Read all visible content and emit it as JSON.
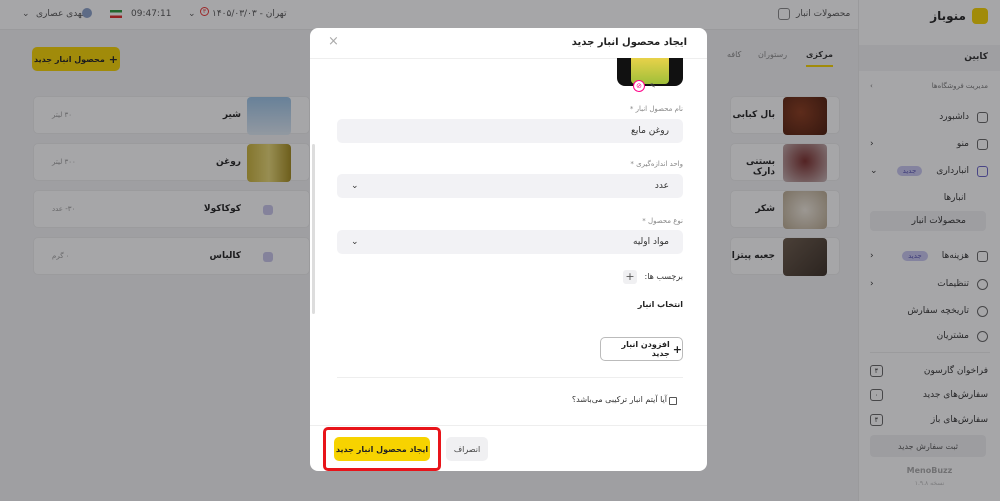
{
  "brand": {
    "name": "منوباز"
  },
  "topbar": {
    "page_label": "محصولات انبار",
    "date": "۱۴۰۵/۰۳/۰۳ - تهران",
    "time": "09:47:11",
    "user": "مهدی عصاری"
  },
  "sidebar": {
    "section": "کابین",
    "manage_stores": "مدیریت فروشگاه‌ها",
    "items": [
      {
        "label": "داشبورد"
      },
      {
        "label": "منو"
      },
      {
        "label": "انبارداری",
        "badge": "جدید"
      },
      {
        "label": "انبارها"
      },
      {
        "label": "محصولات انبار"
      },
      {
        "label": "هزینه‌ها",
        "badge": "جدید"
      },
      {
        "label": "تنظیمات"
      },
      {
        "label": "تاریخچه سفارش"
      },
      {
        "label": "مشتریان"
      }
    ],
    "counters": [
      {
        "label": "فراخوان گارسون",
        "count": "۴"
      },
      {
        "label": "سفارش‌های جدید",
        "count": "۰"
      },
      {
        "label": "سفارش‌های باز",
        "count": "۴"
      }
    ],
    "submit_order": "ثبت سفارش جدید",
    "footer_logo": "MenoBuzz",
    "version": "نسخه ۱.۹.۸"
  },
  "main": {
    "tabs": [
      "مرکزی",
      "رستوران",
      "کافه"
    ],
    "add_button": "محصول انبار جدید",
    "cards": [
      {
        "name": "بال کبابی",
        "qty": ""
      },
      {
        "name": "شیر",
        "qty": "۳۰ لیتر"
      },
      {
        "name": "بستنی دارک",
        "qty": ""
      },
      {
        "name": "روغن",
        "qty": "۳۰۰ لیتر"
      },
      {
        "name": "شکر",
        "qty": ""
      },
      {
        "name": "کوکاکولا",
        "qty": "۳۰- عدد"
      },
      {
        "name": "جعبه پیتزا",
        "qty": ""
      },
      {
        "name": "کالباس",
        "qty": "۰ گرم"
      }
    ]
  },
  "modal": {
    "title": "ایجاد محصول انبار جدید",
    "name_label": "نام محصول انبار *",
    "name_value": "روغن مایع",
    "unit_label": "واحد اندازه‌گیری *",
    "unit_value": "عدد",
    "type_label": "نوع محصول *",
    "type_value": "مواد اولیه",
    "tags_label": "برچسب ها:",
    "warehouse_label": "انتخاب انبار",
    "add_warehouse": "افزودن انبار جدید",
    "composite_question": "آیا آیتم انبار ترکیبی می‌باشد؟",
    "create_button": "ایجاد محصول انبار جدید",
    "cancel_button": "انصراف"
  },
  "colors": {
    "accent": "#f7d300",
    "highlight": "#e8141a",
    "badge": "#c9c7f0"
  },
  "icons": [
    "close-icon",
    "chevron-down-icon",
    "plus-icon",
    "checkbox-icon",
    "flag-icon",
    "user-icon"
  ]
}
